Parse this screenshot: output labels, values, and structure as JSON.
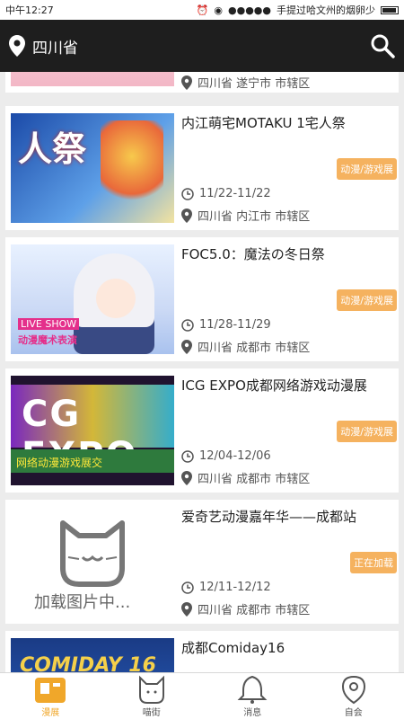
{
  "status_bar": {
    "time": "中午12:27",
    "notice": "手提过哈文州的烟卵少"
  },
  "header": {
    "location": "四川省"
  },
  "events": [
    {
      "title": "",
      "category": "",
      "date": "",
      "address": "四川省 遂宁市 市辖区"
    },
    {
      "title": "内江萌宅MOTAKU 1宅人祭",
      "category": "动漫/游戏展",
      "date": "11/22-11/22",
      "address": "四川省 内江市 市辖区",
      "thumb_text": "人祭"
    },
    {
      "title": "FOC5.0：魔法の冬日祭",
      "category": "动漫/游戏展",
      "date": "11/28-11/29",
      "address": "四川省 成都市 市辖区",
      "thumb_text_1": "LIVE SHOW",
      "thumb_text_2": "动漫魔术表演"
    },
    {
      "title": "ICG EXPO成都网络游戏动漫展",
      "category": "动漫/游戏展",
      "date": "12/04-12/06",
      "address": "四川省 成都市 市辖区",
      "thumb_text_1": "CG EXPO",
      "thumb_text_2": "网络动漫游戏展交"
    },
    {
      "title": "爱奇艺动漫嘉年华——成都站",
      "category": "正在加载",
      "date": "12/11-12/12",
      "address": "四川省 成都市 市辖区",
      "thumb_text": "加载图片中..."
    },
    {
      "title": "成都Comiday16",
      "thumb_text": "COMIDAY 16"
    }
  ],
  "nav": [
    {
      "label": "漫展",
      "icon": "exhibition-icon",
      "active": true
    },
    {
      "label": "喵街",
      "icon": "cat-street-icon",
      "active": false
    },
    {
      "label": "消息",
      "icon": "bell-icon",
      "active": false
    },
    {
      "label": "自会",
      "icon": "profile-icon",
      "active": false
    }
  ],
  "colors": {
    "accent": "#f0a72a",
    "badge": "#f5b25f",
    "appbar": "#1e1e1e"
  }
}
